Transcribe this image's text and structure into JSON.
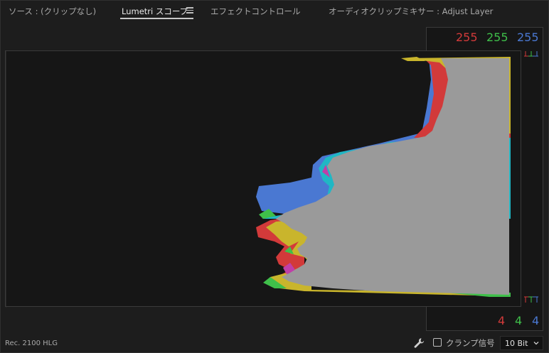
{
  "tabs": [
    {
      "label": "ソース : (クリップなし)",
      "active": false
    },
    {
      "label": "Lumetri スコープ",
      "active": true
    },
    {
      "label": "エフェクトコントロール",
      "active": false
    },
    {
      "label": "オーディオクリップミキサー : Adjust Layer",
      "active": false
    }
  ],
  "readout": {
    "top": {
      "r": "255",
      "g": "255",
      "b": "255"
    },
    "bottom": {
      "r": "4",
      "g": "4",
      "b": "4"
    }
  },
  "colors": {
    "red": "#d23a3a",
    "green": "#3fbf4a",
    "blue": "#4a78d2",
    "yellow": "#c9b52c",
    "cyan": "#20b7c4",
    "magenta": "#c03fa8",
    "gray": "#9a9a9a"
  },
  "icons": {
    "menu": "hamburger-icon",
    "wrench": "wrench-icon",
    "checkbox": "checkbox-unchecked-icon",
    "chevron": "chevron-down-icon"
  },
  "footer": {
    "color_space": "Rec. 2100 HLG",
    "clamp_label": "クランプ信号",
    "clamp_checked": false,
    "bit_depth": "10 Bit"
  }
}
